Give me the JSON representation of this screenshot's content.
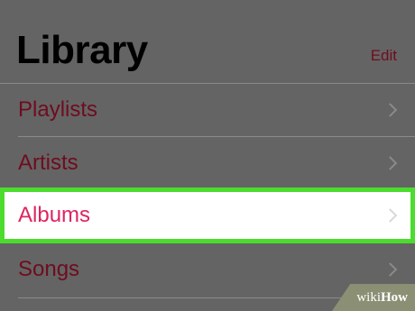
{
  "header": {
    "title": "Library",
    "edit_label": "Edit"
  },
  "rows": [
    {
      "label": "Playlists"
    },
    {
      "label": "Artists"
    },
    {
      "label": "Albums",
      "highlighted": true
    },
    {
      "label": "Songs"
    }
  ],
  "watermark": {
    "text_light": "wiki",
    "text_bold": "How"
  },
  "colors": {
    "accent": "#e0245e",
    "dimmed_accent": "#6f0c1f",
    "highlight_outline": "#4cdc2e",
    "overlay": "#646464"
  }
}
